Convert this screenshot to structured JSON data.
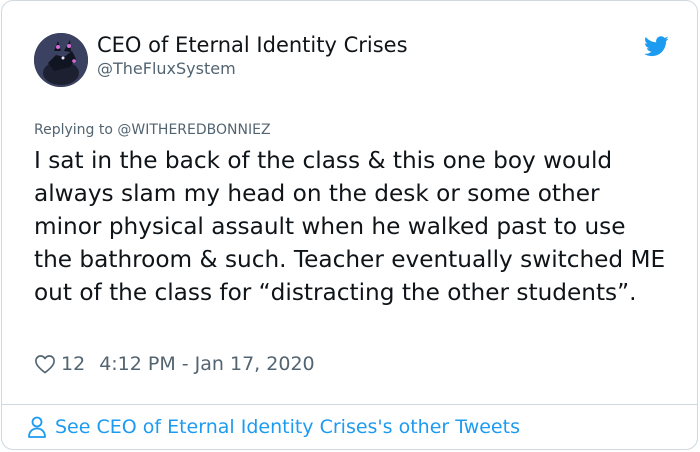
{
  "author": {
    "name": "CEO of Eternal Identity Crises",
    "handle": "@TheFluxSystem"
  },
  "reply": {
    "prefix": "Replying to",
    "mention": "@WITHEREDBONNIEZ"
  },
  "tweet": {
    "text": "I sat in the back of the class & this one boy would always slam my head on the desk or some other minor physical assault when he walked past to use the bathroom & such. Teacher eventually switched ME out of the class for “distracting the other students”.",
    "likes": "12",
    "timestamp": "4:12 PM - Jan 17, 2020"
  },
  "footer": {
    "link_label": "See CEO of Eternal Identity Crises's other Tweets"
  },
  "colors": {
    "accent": "#1d9bf0",
    "text": "#0f1419",
    "muted": "#536471",
    "border": "#cfd9de"
  },
  "icons": {
    "brand": "twitter-bird-icon",
    "like": "heart-outline-icon",
    "profile": "person-icon"
  }
}
